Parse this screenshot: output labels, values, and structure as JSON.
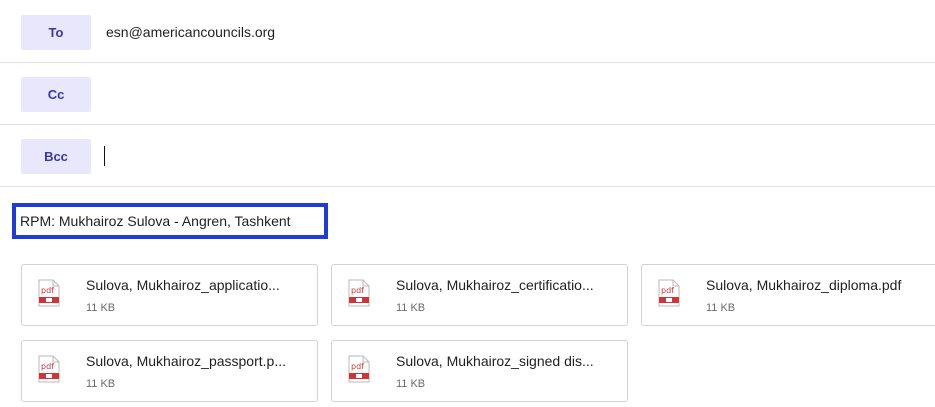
{
  "recipients": {
    "to_label": "To",
    "to_value": "esn@americancouncils.org",
    "cc_label": "Cc",
    "bcc_label": "Bcc"
  },
  "subject": {
    "value": "RPM: Mukhairoz Sulova - Angren, Tashkent",
    "highlight_color": "#1f3bdb"
  },
  "attachments": [
    {
      "name": "Sulova, Mukhairoz_applicatio...",
      "size": "11 KB",
      "icon": "pdf-icon"
    },
    {
      "name": "Sulova, Mukhairoz_certificatio...",
      "size": "11 KB",
      "icon": "pdf-icon"
    },
    {
      "name": "Sulova, Mukhairoz_diploma.pdf",
      "size": "11 KB",
      "icon": "pdf-icon"
    },
    {
      "name": "Sulova, Mukhairoz_passport.p...",
      "size": "11 KB",
      "icon": "pdf-icon"
    },
    {
      "name": "Sulova, Mukhairoz_signed dis...",
      "size": "11 KB",
      "icon": "pdf-icon"
    }
  ],
  "icon_label": "pdf",
  "colors": {
    "field_button_bg": "#e8e7fb",
    "field_button_text": "#3c36a8",
    "pdf_red": "#d13438"
  }
}
